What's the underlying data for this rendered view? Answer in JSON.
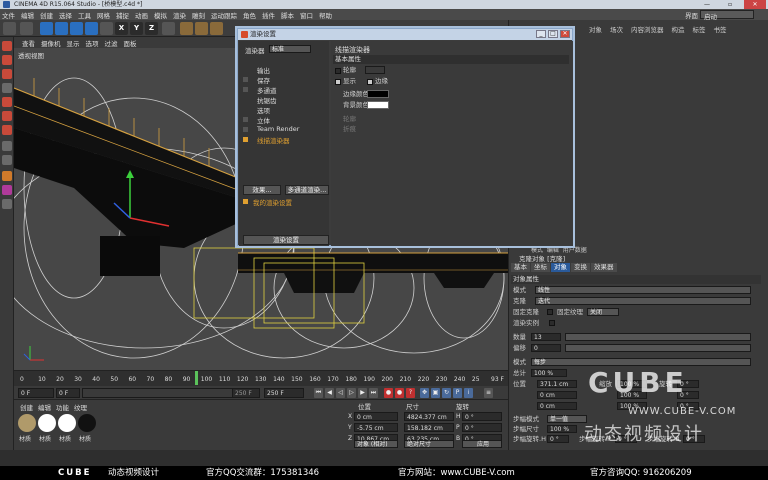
{
  "window": {
    "title": "CINEMA 4D R15.064 Studio - [桥模型.c4d *]",
    "controls": [
      "最小化",
      "还原",
      "关闭"
    ]
  },
  "menubar": [
    "文件",
    "编辑",
    "创建",
    "选择",
    "工具",
    "网格",
    "捕捉",
    "动画",
    "模拟",
    "渲染",
    "雕刻",
    "运动跟踪",
    "角色",
    "插件",
    "脚本",
    "窗口",
    "帮助"
  ],
  "layout": {
    "label": "界面",
    "value": "启动"
  },
  "toolbar": {
    "axes": [
      "X",
      "Y",
      "Z"
    ]
  },
  "viewport": {
    "menu": [
      "查看",
      "摄像机",
      "显示",
      "选项",
      "过滤",
      "面板"
    ],
    "label": "透视视图"
  },
  "right_panel": {
    "tabs": [
      "对象",
      "场次",
      "内容浏览器",
      "构造",
      "标签",
      "书签"
    ]
  },
  "render_dialog": {
    "title": "渲染设置",
    "renderer_label": "渲染器",
    "renderer_value": "标准",
    "items": [
      "输出",
      "保存",
      "多通道",
      "抗锯齿",
      "选项",
      "立体",
      "Team Render",
      "线描渲染器"
    ],
    "active_item": "线描渲染器",
    "effect_button": "效果...",
    "multipass_button": "多通道渲染...",
    "my_settings": "我的渲染设置",
    "render_settings_button": "渲染设置",
    "panel_title": "线描渲染器",
    "section": "基本属性",
    "fields": [
      {
        "label": "轮廓",
        "checked": false
      },
      {
        "label": "显示",
        "checked": true
      },
      {
        "label": "边缘",
        "checked": true
      },
      {
        "label": "边缘颜色",
        "color": "#000000"
      },
      {
        "label": "背景颜色",
        "color": "#ffffff"
      }
    ],
    "greyed": [
      "轮廓",
      "折痕"
    ]
  },
  "attributes": {
    "menu": [
      "模式",
      "编辑",
      "用户数据"
    ],
    "object_title": "克隆对象 [克隆]",
    "tabs": [
      "基本",
      "坐标",
      "对象",
      "变换",
      "效果器"
    ],
    "active_tab": "对象",
    "section": "对象属性",
    "rows": {
      "mode_label": "模式",
      "mode_value": "线性",
      "clones_label": "克隆",
      "clones_value": "迭代",
      "fixclone_label": "固定克隆",
      "fixtexture_label": "固定纹理",
      "fixtexture_value": "关闭",
      "instance_label": "渲染实例",
      "count_label": "数量",
      "count_value": "13",
      "offset_label": "偏移",
      "offset_value": "0",
      "mode2_label": "模式",
      "mode2_value": "每步",
      "total_label": "总计",
      "total_value": "100 %",
      "pos_label": "位置",
      "pos_x": "371.1 cm",
      "pos_y": "0 cm",
      "pos_z": "0 cm",
      "scale_label": "缩放",
      "scale_x": "100 %",
      "scale_y": "100 %",
      "scale_z": "100 %",
      "rot_label": "旋转",
      "rot_h": "0 °",
      "rot_p": "0 °",
      "rot_b": "0 °",
      "step_mode_label": "步幅模式",
      "step_mode_value": "单一值",
      "step_size_label": "步幅尺寸",
      "step_size_value": "100 %",
      "step_rot_h_label": "步幅旋转.H",
      "step_rot_h_value": "0 °",
      "step_rot_p_label": "步幅旋转.P",
      "step_rot_p_value": "0 °",
      "step_rot_b_label": "步幅旋转.B",
      "step_rot_b_value": "0 °"
    }
  },
  "timeline": {
    "ticks": [
      "0",
      "10",
      "20",
      "30",
      "40",
      "50",
      "60",
      "70",
      "80",
      "90",
      "100",
      "110",
      "120",
      "130",
      "140",
      "150",
      "160",
      "170",
      "180",
      "190",
      "200",
      "210",
      "220",
      "230",
      "240",
      "25"
    ],
    "current": "93",
    "end_label": "93 F",
    "playhead_fraction": 0.372
  },
  "transport": {
    "start": "0 F",
    "min": "0 F",
    "max": "250 F",
    "end": "250 F"
  },
  "materials": {
    "menu": [
      "创建",
      "编辑",
      "功能",
      "纹理"
    ],
    "items": [
      {
        "label": "材质",
        "color": "#b09a6a"
      },
      {
        "label": "材质",
        "color": "#ffffff"
      },
      {
        "label": "材质",
        "color": "#ffffff"
      },
      {
        "label": "材质",
        "color": "#111111"
      }
    ]
  },
  "coordinates": {
    "headers": [
      "位置",
      "尺寸",
      "旋转"
    ],
    "x": {
      "pos": "0 cm",
      "size": "4824.377 cm",
      "rot": "0 °",
      "rot_label": "H"
    },
    "y": {
      "pos": "-5.75 cm",
      "size": "158.182 cm",
      "rot": "0 °",
      "rot_label": "P"
    },
    "z": {
      "pos": "10.867 cm",
      "size": "63.235 cm",
      "rot": "0 °",
      "rot_label": "B"
    },
    "mode": "对象 (相对)",
    "size_mode": "绝对尺寸",
    "apply": "应用"
  },
  "watermark": {
    "logo": "CUBE",
    "url": "WWW.CUBE-V.COM",
    "cn": "动态视频设计"
  },
  "banner": {
    "logo": "CUBE",
    "brand": "动态视频设计",
    "qq_group": "官方QQ交流群：175381346",
    "site": "官方网站：www.CUBE-V.com",
    "consult": "官方咨询QQ: 916206209"
  }
}
